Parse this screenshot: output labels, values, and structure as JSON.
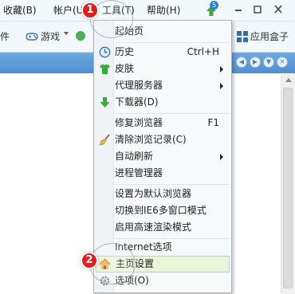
{
  "menubar": {
    "items": [
      {
        "label": "收藏(B)"
      },
      {
        "label": "帐户(U)"
      },
      {
        "label": "工具(T)"
      },
      {
        "label": "帮助(H)"
      }
    ],
    "badge_count": "5"
  },
  "toolbar": {
    "items": [
      {
        "label": "件"
      },
      {
        "label": "游戏"
      },
      {
        "label": "应用盒子"
      }
    ]
  },
  "tools_menu": {
    "items": [
      {
        "label": "起始页",
        "shortcut": "",
        "icon": ""
      },
      {
        "label": "历史",
        "shortcut": "Ctrl+H",
        "icon": "clock-icon"
      },
      {
        "label": "皮肤",
        "shortcut": "",
        "icon": "tshirt-icon"
      },
      {
        "label": "代理服务器",
        "shortcut": "",
        "icon": ""
      },
      {
        "label": "下载器(D)",
        "shortcut": "",
        "icon": "download-arrow-icon"
      },
      {
        "label": "修复浏览器",
        "shortcut": "F1",
        "icon": ""
      },
      {
        "label": "清除浏览记录(C)",
        "shortcut": "",
        "icon": "broom-icon"
      },
      {
        "label": "自动刷新",
        "shortcut": "",
        "icon": ""
      },
      {
        "label": "进程管理器",
        "shortcut": "",
        "icon": ""
      },
      {
        "label": "设置为默认浏览器",
        "shortcut": "",
        "icon": ""
      },
      {
        "label": "切换到IE6多窗口模式",
        "shortcut": "",
        "icon": ""
      },
      {
        "label": "启用高速渲染模式",
        "shortcut": "",
        "icon": ""
      },
      {
        "label": "Internet选项",
        "shortcut": "",
        "icon": ""
      },
      {
        "label": "主页设置",
        "shortcut": "",
        "icon": "home-icon"
      },
      {
        "label": "选项(O)",
        "shortcut": "",
        "icon": "gear-icon"
      }
    ]
  },
  "annotations": {
    "step1": "1",
    "step2": "2"
  },
  "colors": {
    "accent_blue": "#4e8fd0",
    "highlight": "#eaf4d9",
    "marker_red": "#e21d1d"
  }
}
